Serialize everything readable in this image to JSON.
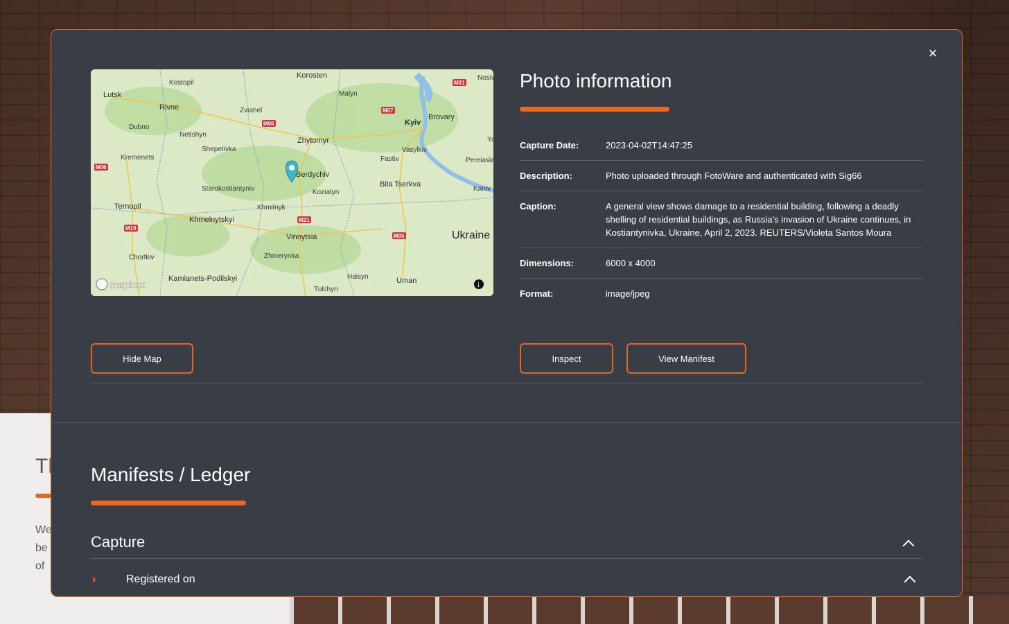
{
  "background": {
    "heading": "Th",
    "text": "We wo Ca Sta for photographic metadata to be digitally signed on the device at the point of"
  },
  "map": {
    "attribution": "mapbox",
    "country": "Ukraine",
    "cities": [
      "Korosten",
      "Kostopil",
      "Lutsk",
      "Rivne",
      "Malyn",
      "Zviahel",
      "Dubno",
      "Kyiv",
      "Brovary",
      "Netishyn",
      "Zhytomyr",
      "Shepetivka",
      "Kremenets",
      "Vasylkiv",
      "Fastiv",
      "Pereiaslav",
      "Berdychiv",
      "Starokostiantyniv",
      "Koziatyn",
      "Bila Tserkva",
      "Kaniv",
      "Ternopil",
      "Khmilnyk",
      "Khmelnytskyi",
      "Vinnytsia",
      "Chortkiv",
      "Zhmerynka",
      "Haisyn",
      "Kamianets-Podilskyi",
      "Uman",
      "Tulchyn",
      "Nosiv",
      "Ya"
    ],
    "roads": [
      "M01",
      "M07",
      "M06",
      "M06",
      "M21",
      "M19",
      "M05"
    ]
  },
  "info": {
    "title": "Photo information",
    "rows": [
      {
        "key": "Capture Date:",
        "value": "2023-04-02T14:47:25"
      },
      {
        "key": "Description:",
        "value": "Photo uploaded through FotoWare and authenticated with Sig66"
      },
      {
        "key": "Caption:",
        "value": "A general view shows damage to a residential building, following a deadly shelling of residential buildings, as Russia's invasion of Ukraine continues, in Kostiantynivka, Ukraine, April 2, 2023. REUTERS/Violeta Santos Moura"
      },
      {
        "key": "Dimensions:",
        "value": "6000 x 4000"
      },
      {
        "key": "Format:",
        "value": "image/jpeg"
      }
    ]
  },
  "buttons": {
    "hide_map": "Hide Map",
    "inspect": "Inspect",
    "view_manifest": "View Manifest",
    "close": "×"
  },
  "ledger": {
    "title": "Manifests / Ledger",
    "capture_label": "Capture",
    "registered_label": "Registered on"
  },
  "colors": {
    "modal_bg": "#383d46",
    "accent": "#f0661e",
    "text": "#ffffff"
  },
  "icons": {
    "close": "close-icon",
    "map_pin": "map-pin-icon",
    "chevron_up": "chevron-up-icon",
    "caret_right": "caret-right-icon",
    "info": "info-icon"
  }
}
